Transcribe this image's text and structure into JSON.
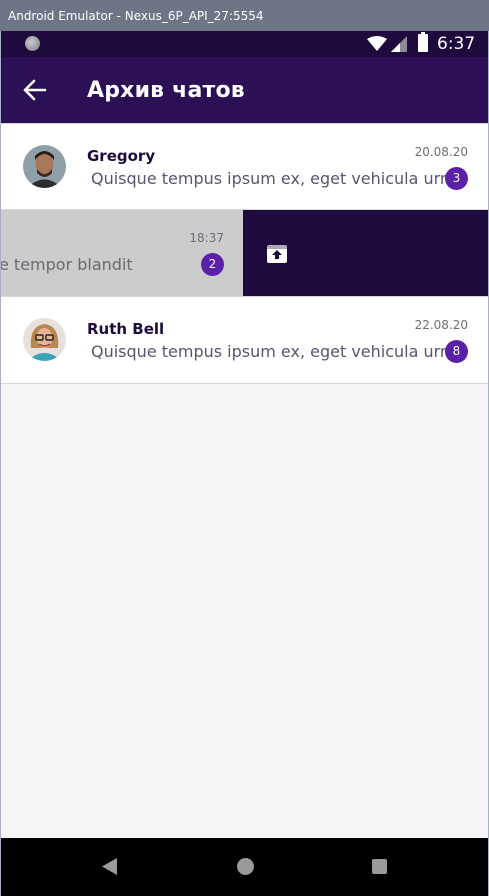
{
  "window": {
    "title": "Android Emulator - Nexus_6P_API_27:5554"
  },
  "status_bar": {
    "time": "6:37",
    "icons": [
      "notification-dot-icon",
      "wifi-icon",
      "signal-icon",
      "battery-icon"
    ]
  },
  "app_bar": {
    "title": "Архив чатов",
    "back_icon": "arrow-left-icon"
  },
  "chats": [
    {
      "name": "Gregory",
      "preview": "Quisque tempus ipsum ex, eget vehicula urna",
      "date": "20.08.20",
      "unread": "3"
    },
    {
      "name": "",
      "preview": "e tempor blandit",
      "date": "18:37",
      "unread": "2",
      "swipe_action_icon": "unarchive-icon"
    },
    {
      "name": "Ruth Bell",
      "preview": "Quisque tempus ipsum ex, eget vehicula urna",
      "date": "22.08.20",
      "unread": "8"
    }
  ],
  "nav_bar": {
    "icons": [
      "nav-back-icon",
      "nav-home-icon",
      "nav-recent-icon"
    ]
  },
  "colors": {
    "app_bar": "#2b1055",
    "status_bar": "#1e0a3c",
    "badge": "#5b1fa8",
    "swipe_action": "#1e0a3c"
  }
}
